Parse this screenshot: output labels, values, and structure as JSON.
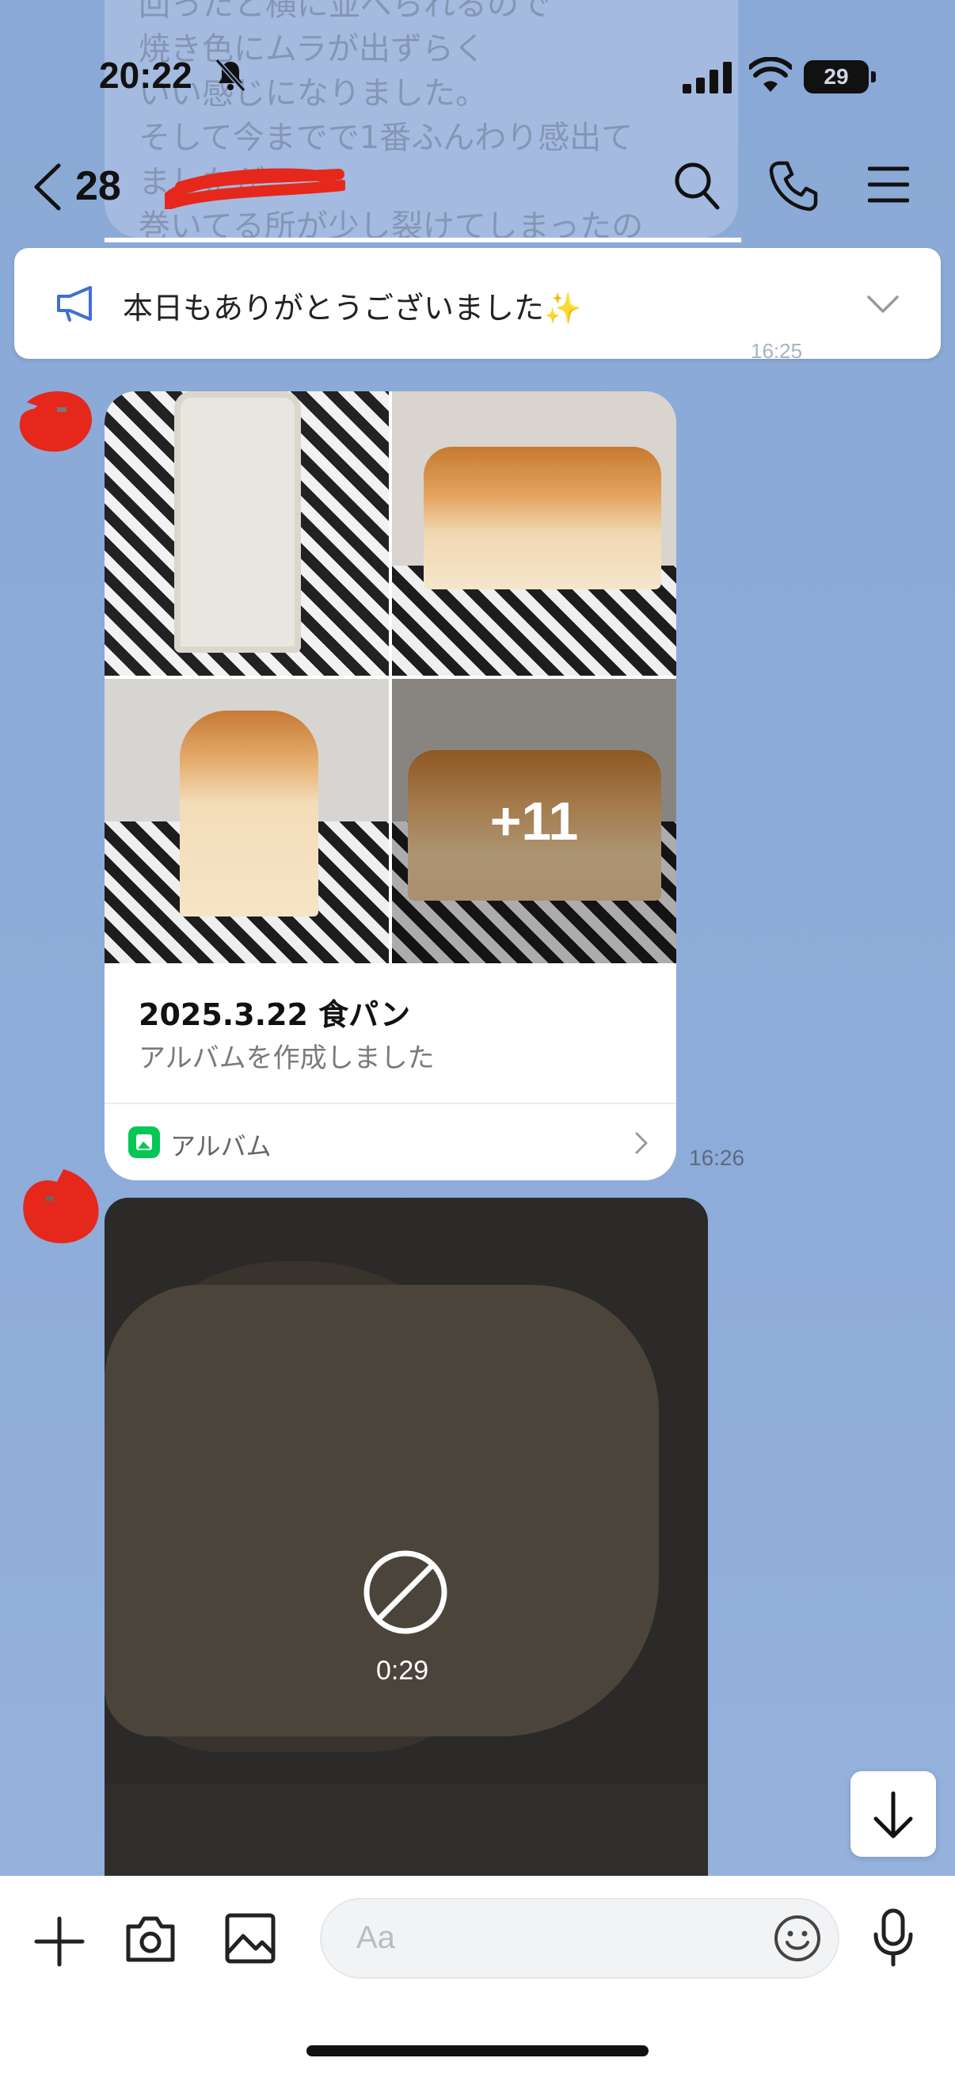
{
  "background_chat": {
    "ghost_lines": "回ったと横に並べられるので\n焼き色にムラが出ずらく\nいい感じになりました。\nそして今までで1番ふんわり感出て\nましたが、\n巻いてる所が少し裂けてしまったの",
    "ghost_time": "16:25"
  },
  "status_bar": {
    "time": "20:22",
    "battery_level": "29"
  },
  "header": {
    "member_count": "28"
  },
  "announcement": {
    "text": "本日もありがとうございました✨"
  },
  "album_message": {
    "more_count": "+11",
    "title": "2025.3.22 食パン",
    "subtitle": "アルバムを作成しました",
    "footer_label": "アルバム",
    "time": "16:26"
  },
  "video_message": {
    "duration": "0:29"
  },
  "composer": {
    "placeholder": "Aa"
  },
  "colors": {
    "chat_background": "#8eacd9",
    "line_green": "#06c755",
    "redaction_red": "#e5281b"
  }
}
